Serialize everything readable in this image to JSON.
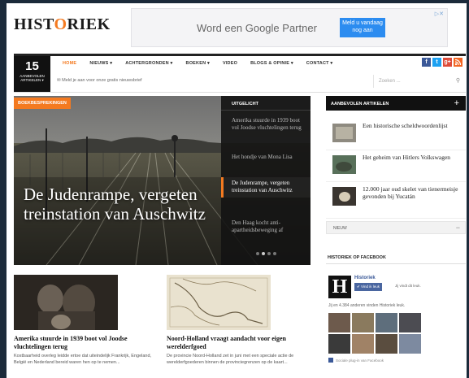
{
  "header": {
    "logo_prefix": "HIST",
    "logo_o": "O",
    "logo_suffix": "RIEK",
    "ad_text": "Word een Google Partner",
    "ad_button": "Meld u vandaag nog aan",
    "ad_choices": "▷✕"
  },
  "nav": {
    "date_number": "15",
    "date_caption": "AANBEVOLEN ARTIKELEN ▾",
    "items": [
      "HOME",
      "NIEUWS ▾",
      "ACHTERGRONDEN ▾",
      "BOEKEN ▾",
      "VIDEO",
      "BLOGS & OPINIE ▾",
      "CONTACT ▾"
    ],
    "newsletter": "✉ Meld je aan voor onze gratis nieuwsbrief",
    "search_placeholder": "Zoeken ...",
    "social": [
      "f",
      "t",
      "g+",
      "rss"
    ]
  },
  "hero": {
    "tag": "BOEKBESPREKINGEN",
    "title": "De Judenrampe, vergeten treinstation van Auschwitz",
    "featured_heading": "UITGELICHT",
    "featured": [
      "Amerika stuurde in 1939 boot vol Joodse vluchtelingen terug",
      "Het hondje van Mona Lisa",
      "De Judenrampe, vergeten treinstation van Auschwitz",
      "Den Haag kocht anti-apartheidsbeweging af"
    ]
  },
  "articles": [
    {
      "title": "Amerika stuurde in 1939 boot vol Joodse vluchtelingen terug",
      "excerpt": "Kostbaarheid overleg leidde ertoe dat uiteindelijk Frankrijk, Engeland, België en Nederland bereid waren hen op te nemen..."
    },
    {
      "title": "Noord-Holland vraagt aandacht voor eigen werelderfgoed",
      "excerpt": "De provincie Noord-Holland zet in juni met een speciale actie de werelderfgoederen binnen de provinciegrenzen op de kaart..."
    }
  ],
  "sidebar": {
    "heading": "AANBEVOLEN ARTIKELEN",
    "plus": "+",
    "items": [
      "Een historische scheldwoordenlijst",
      "Het geheim van Hitlers Volkswagen",
      "12.000 jaar oud skelet van tienermeisje gevonden bij Yucatán"
    ],
    "new_label": "NIEUW",
    "minus": "−"
  },
  "facebook": {
    "heading": "HISTORIEK OP FACEBOOK",
    "page_name": "Historiek",
    "like_button": "✔ Vind ik leuk",
    "like_note": "Jij vindt dit leuk.",
    "count_text": "Jij en 4.384 anderen vinden Historiek leuk.",
    "plugin": "Sociale plug-in van Facebook"
  },
  "colors": {
    "accent": "#f47a20",
    "facebook": "#3b5998",
    "twitter": "#1da1f2",
    "googleplus": "#dd4b39",
    "rss": "#f26522"
  }
}
